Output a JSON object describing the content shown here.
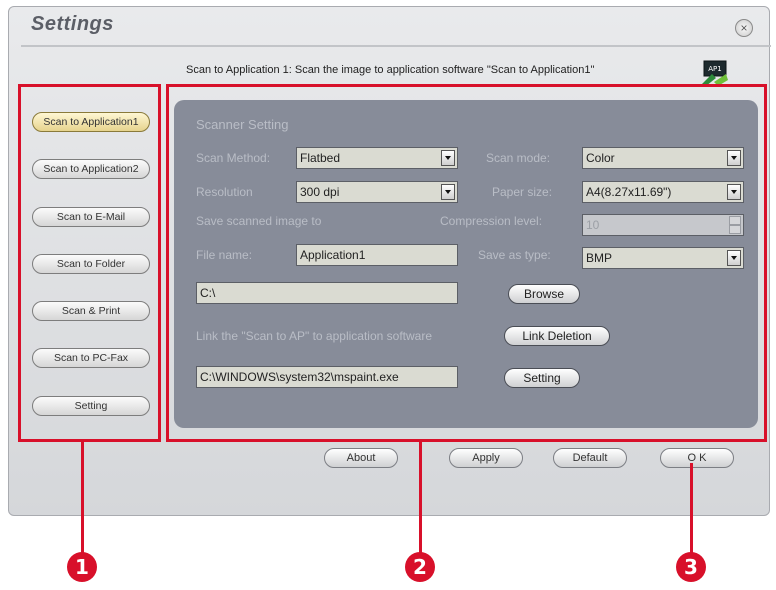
{
  "window": {
    "title": "Settings",
    "close_icon": "×"
  },
  "description": "Scan to Application 1: Scan the image to application software \"Scan to Application1\"",
  "app_icon_text": "AP1",
  "sidebar": {
    "items": [
      {
        "label": "Scan to Application1",
        "active": true
      },
      {
        "label": "Scan to Application2"
      },
      {
        "label": "Scan to E-Mail"
      },
      {
        "label": "Scan to Folder"
      },
      {
        "label": "Scan & Print"
      },
      {
        "label": "Scan to PC-Fax"
      },
      {
        "label": "Setting"
      }
    ]
  },
  "panel": {
    "section_title": "Scanner Setting",
    "scan_method": {
      "label": "Scan Method:",
      "value": "Flatbed"
    },
    "scan_mode": {
      "label": "Scan mode:",
      "value": "Color"
    },
    "resolution": {
      "label": "Resolution",
      "value": "300 dpi"
    },
    "paper_size": {
      "label": "Paper size:",
      "value": "A4(8.27x11.69\")"
    },
    "save_scanned_label": "Save scanned image to",
    "compression": {
      "label": "Compression level:",
      "value": "10"
    },
    "file_name": {
      "label": "File name:",
      "value": "Application1"
    },
    "save_as_type": {
      "label": "Save as type:",
      "value": "BMP"
    },
    "path_value": "C:\\",
    "browse_label": "Browse",
    "link_label": "Link the \"Scan to AP\" to application software",
    "link_deletion_label": "Link Deletion",
    "app_path_value": "C:\\WINDOWS\\system32\\mspaint.exe",
    "setting_label": "Setting"
  },
  "bottom_buttons": {
    "about": "About",
    "apply": "Apply",
    "default": "Default",
    "ok": "O K"
  },
  "markers": [
    "1",
    "2",
    "3"
  ],
  "colors": {
    "accent_red": "#d8102a",
    "panel": "#878c99"
  }
}
